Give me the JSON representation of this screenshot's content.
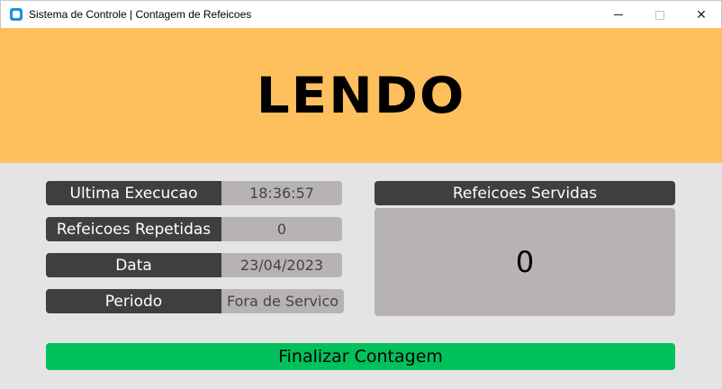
{
  "window": {
    "title": "Sistema de Controle | Contagem de Refeicoes",
    "close_glyph": "✕"
  },
  "status": {
    "text": "LENDO",
    "color": "#fec05c"
  },
  "info": {
    "rows": [
      {
        "label": "Ultima Execucao",
        "value": "18:36:57"
      },
      {
        "label": "Refeicoes Repetidas",
        "value": "0"
      },
      {
        "label": "Data",
        "value": "23/04/2023"
      },
      {
        "label": "Periodo",
        "value": "Fora de Servico"
      }
    ]
  },
  "served": {
    "label": "Refeicoes Servidas",
    "count": "0"
  },
  "actions": {
    "finish_label": "Finalizar Contagem",
    "finish_color": "#00c15c"
  }
}
